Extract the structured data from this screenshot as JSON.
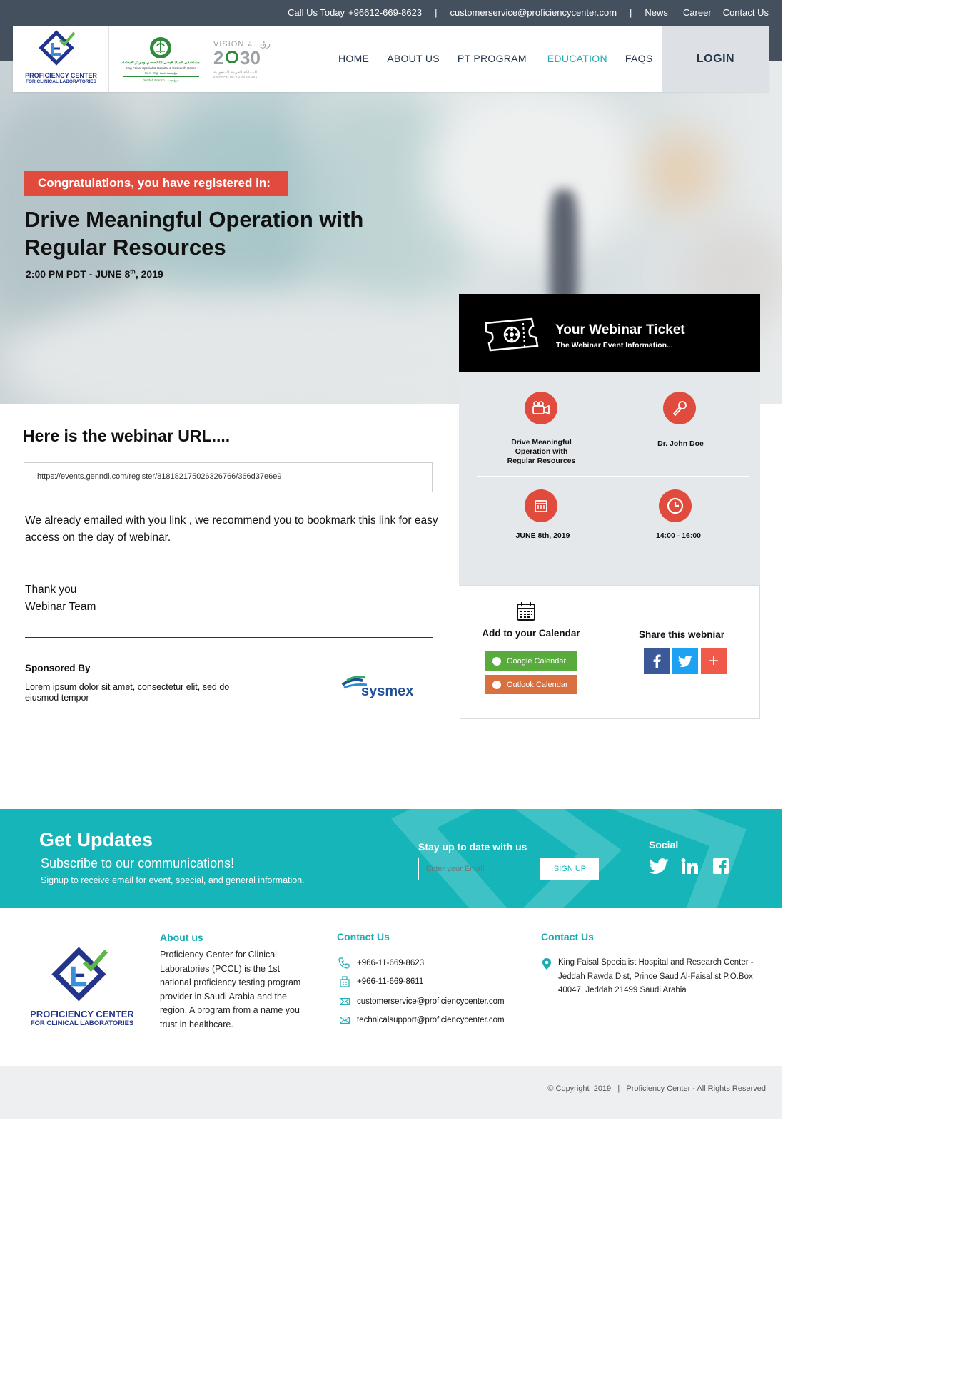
{
  "topbar": {
    "call_label": "Call Us Today",
    "phone": "+96612-669-8623",
    "separator": "|",
    "email": "customerservice@proficiencycenter.com",
    "links": [
      "News",
      "Career",
      "Contact Us"
    ]
  },
  "logo": {
    "line1": "PROFICIENCY CENTER",
    "line2": "FOR CLINICAL LABORATORIES"
  },
  "partner_logos": {
    "kfsh_ar": "مستشفى الملك فيصل التخصصي ومركز الأبحاث",
    "kfsh_en": "King Faisal Specialist Hospital & Research Centre",
    "kfsh_sub": "Gen. Org.   مؤسسة عامة",
    "kfsh_branch": "Jeddah Branch - فرع جدة",
    "vision_word": "VISION",
    "vision_ar": "رؤيـــة",
    "vision_year_a": "2",
    "vision_year_b": "30",
    "vision_country_ar": "المملكة العربية السعودية",
    "vision_country_en": "KINGDOM OF SAUDI ARABIA"
  },
  "nav": {
    "items": [
      "HOME",
      "ABOUT US",
      "PT PROGRAM",
      "EDUCATION",
      "FAQS"
    ],
    "active": "EDUCATION",
    "login": "LOGIN"
  },
  "hero": {
    "congrats": "Congratulations, you have registered in:",
    "title_line1": "Drive Meaningful Operation with",
    "title_line2": "Regular Resources",
    "date_pre": "2:00 PM PDT - JUNE 8",
    "date_sup": "th",
    "date_post": ", 2019"
  },
  "ticket": {
    "title": "Your Webinar Ticket",
    "subtitle": "The Webinar Event Information...",
    "event_line1": "Drive Meaningful",
    "event_line2": "Operation with",
    "event_line3": "Regular Resources",
    "speaker": "Dr. John Doe",
    "date": "JUNE 8th, 2019",
    "time": "14:00 - 16:00",
    "calendar_title": "Add to your Calendar",
    "google_btn": "Google Calendar",
    "outlook_btn": "Outlook Calendar",
    "share_title": "Share this webniar",
    "share_plus": "+",
    "colors": {
      "google": "#5aab3d",
      "outlook": "#d9703f",
      "facebook": "#3b5998",
      "twitter": "#1da1f2",
      "plus": "#ef5a4a"
    }
  },
  "webinar": {
    "url_title": "Here is the webinar URL....",
    "url": "https://events.genndi.com/register/818182175026326766/366d37e6e9",
    "message": "We already emailed with you link , we recommend you to bookmark this link for easy access on the day of webinar.",
    "thanks_line1": "Thank you",
    "thanks_line2": "Webinar Team",
    "sponsor_title": "Sponsored By",
    "sponsor_desc": "Lorem ipsum dolor sit amet, consectetur elit, sed do eiusmod tempor",
    "sponsor_logo": "sysmex"
  },
  "updates": {
    "title": "Get Updates",
    "subtitle": "Subscribe to our communications!",
    "desc": "Signup to receive email for event, special, and general information.",
    "stay": "Stay up to date with us",
    "email_placeholder": "Enter your Email",
    "signup": "SIGN UP",
    "social_title": "Social"
  },
  "footer": {
    "about_title": "About us",
    "about_text": "Proficiency Center for Clinical Laboratories (PCCL) is the 1st national proficiency testing program provider in Saudi Arabia and the region. A program from a name you trust in healthcare.",
    "contact_title_1": "Contact Us",
    "phone1": "+966-11-669-8623",
    "fax": "+966-11-669-8611",
    "email1": "customerservice@proficiencycenter.com",
    "email2": "technicalsupport@proficiencycenter.com",
    "contact_title_2": "Contact Us",
    "address": "King Faisal Specialist Hospital and Research Center - Jeddah Rawda Dist, Prince Saud Al-Faisal st  P.O.Box 40047, Jeddah 21499 Saudi Arabia",
    "copyright": "© Copyright  2019   |   Proficiency Center - All Rights Reserved"
  }
}
